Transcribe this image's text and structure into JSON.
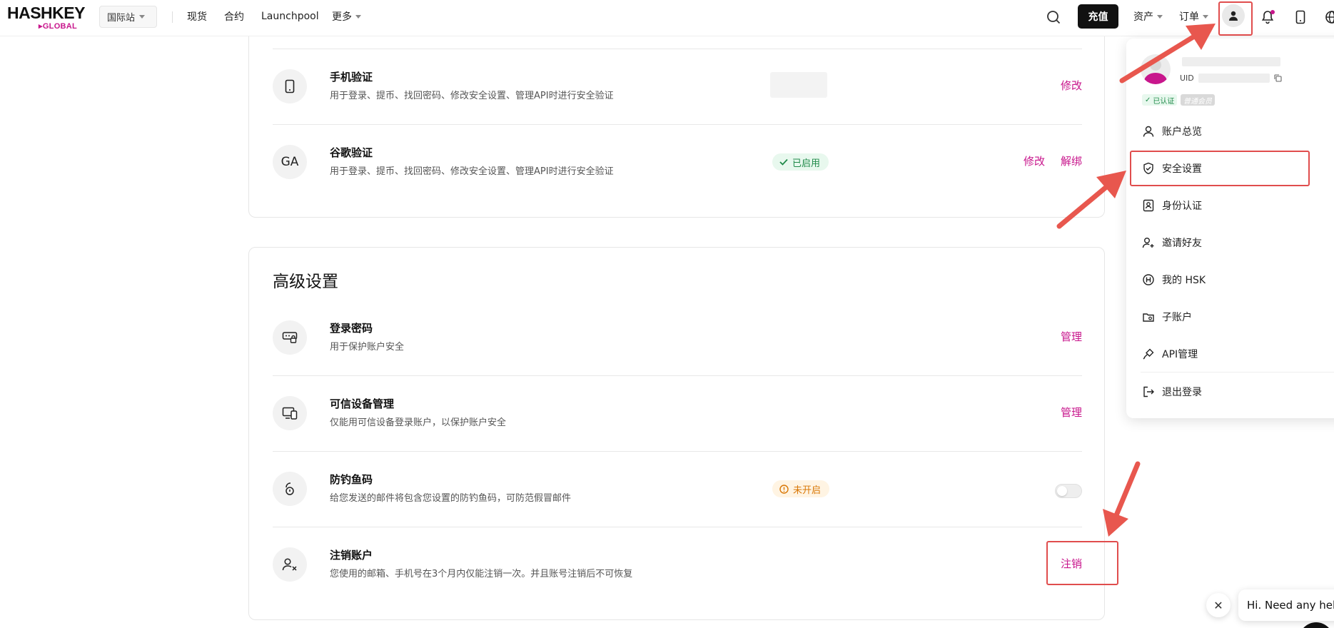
{
  "header": {
    "logo_main": "HASHKEY",
    "logo_sub": "GLOBAL",
    "site_select": "国际站",
    "nav": [
      "现货",
      "合约",
      "Launchpool",
      "更多"
    ],
    "deposit": "充值",
    "assets": "资产",
    "orders": "订单"
  },
  "security_auth": {
    "rows": [
      {
        "icon": "phone-icon",
        "title": "手机验证",
        "desc": "用于登录、提币、找回密码、修改安全设置、管理API时进行安全验证",
        "actions": [
          "修改"
        ]
      },
      {
        "icon_text": "GA",
        "title": "谷歌验证",
        "desc": "用于登录、提币、找回密码、修改安全设置、管理API时进行安全验证",
        "status": "已启用",
        "actions": [
          "修改",
          "解绑"
        ]
      }
    ]
  },
  "advanced": {
    "title": "高级设置",
    "rows": [
      {
        "icon": "password-icon",
        "title": "登录密码",
        "desc": "用于保护账户安全",
        "actions": [
          "管理"
        ]
      },
      {
        "icon": "devices-icon",
        "title": "可信设备管理",
        "desc": "仅能用可信设备登录账户，以保护账户安全",
        "actions": [
          "管理"
        ]
      },
      {
        "icon": "anti-phishing-icon",
        "title": "防钓鱼码",
        "desc": "给您发送的邮件将包含您设置的防钓鱼码，可防范假冒邮件",
        "status": "未开启",
        "toggle": false
      },
      {
        "icon": "delete-user-icon",
        "title": "注销账户",
        "desc": "您使用的邮箱、手机号在3个月内仅能注销一次。并且账号注销后不可恢复",
        "actions": [
          "注销"
        ]
      }
    ]
  },
  "user_menu": {
    "uid_label": "UID",
    "verified": "已认证",
    "member": "普通会员",
    "items": [
      "账户总览",
      "安全设置",
      "身份认证",
      "邀请好友",
      "我的 HSK",
      "子账户",
      "API管理",
      "退出登录"
    ]
  },
  "chat": {
    "text": "Hi. Need any help?"
  },
  "colors": {
    "accent": "#c8168c",
    "highlight": "#e04d4d",
    "success": "#1f8a49",
    "warning": "#d97706"
  }
}
